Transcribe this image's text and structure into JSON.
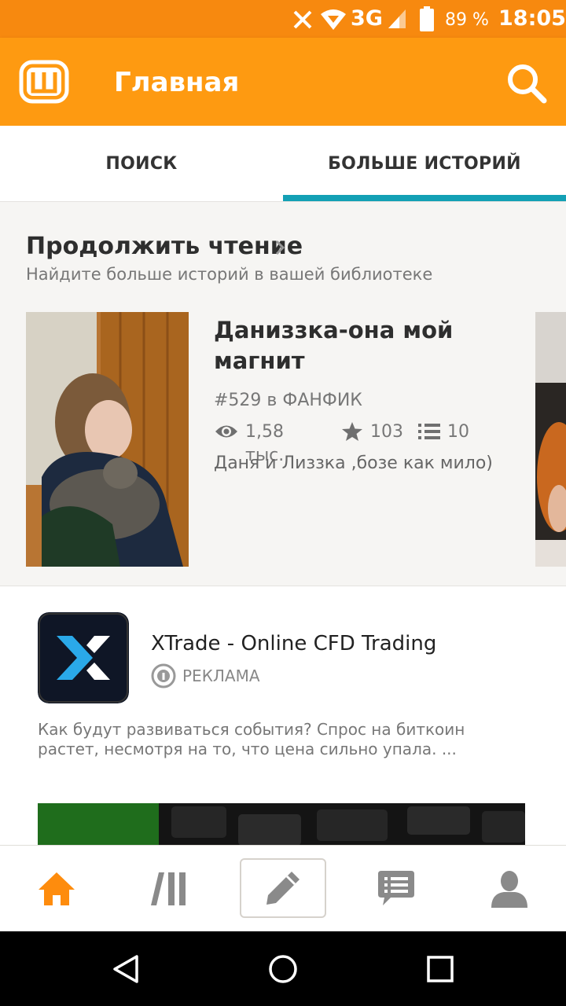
{
  "status_bar": {
    "battery": "89 %",
    "time": "18:05",
    "network": "3G",
    "icons": [
      "x-notification-icon",
      "wifi-icon",
      "signal-icon",
      "battery-icon"
    ]
  },
  "app_bar": {
    "title": "Главная",
    "logo_icon": "wattpad-logo-icon",
    "search_icon": "search-icon",
    "color": "#fe9a11"
  },
  "tabs": [
    {
      "label": "ПОИСК",
      "active": false
    },
    {
      "label": "БОЛЬШЕ ИСТОРИЙ",
      "active": true
    }
  ],
  "accent_color": "#13a0b5",
  "continue_reading": {
    "title": "Продолжить чтение",
    "subtitle": "Найдите больше историй в вашей библиотеке",
    "story": {
      "title": "Даниззка-она мой магнит",
      "rank": "#529 в ФАНФИК",
      "reads": "1,58 тыс.",
      "votes": "103",
      "parts": "10",
      "description": "Даня и Лиззка ,бозе как мило)"
    }
  },
  "ad": {
    "title": "XTrade - Online CFD Trading",
    "badge": "РЕКЛАМА",
    "text": "Как будут развиваться события? Спрос на биткоин растет, несмотря на то, что цена сильно упала. ..."
  },
  "bottom_nav": [
    {
      "icon": "home-icon",
      "active": true
    },
    {
      "icon": "library-icon",
      "active": false
    },
    {
      "icon": "pencil-icon",
      "active": false
    },
    {
      "icon": "messages-icon",
      "active": false
    },
    {
      "icon": "profile-icon",
      "active": false
    }
  ],
  "system_nav": [
    "back-icon",
    "home-circle-icon",
    "recents-icon"
  ]
}
